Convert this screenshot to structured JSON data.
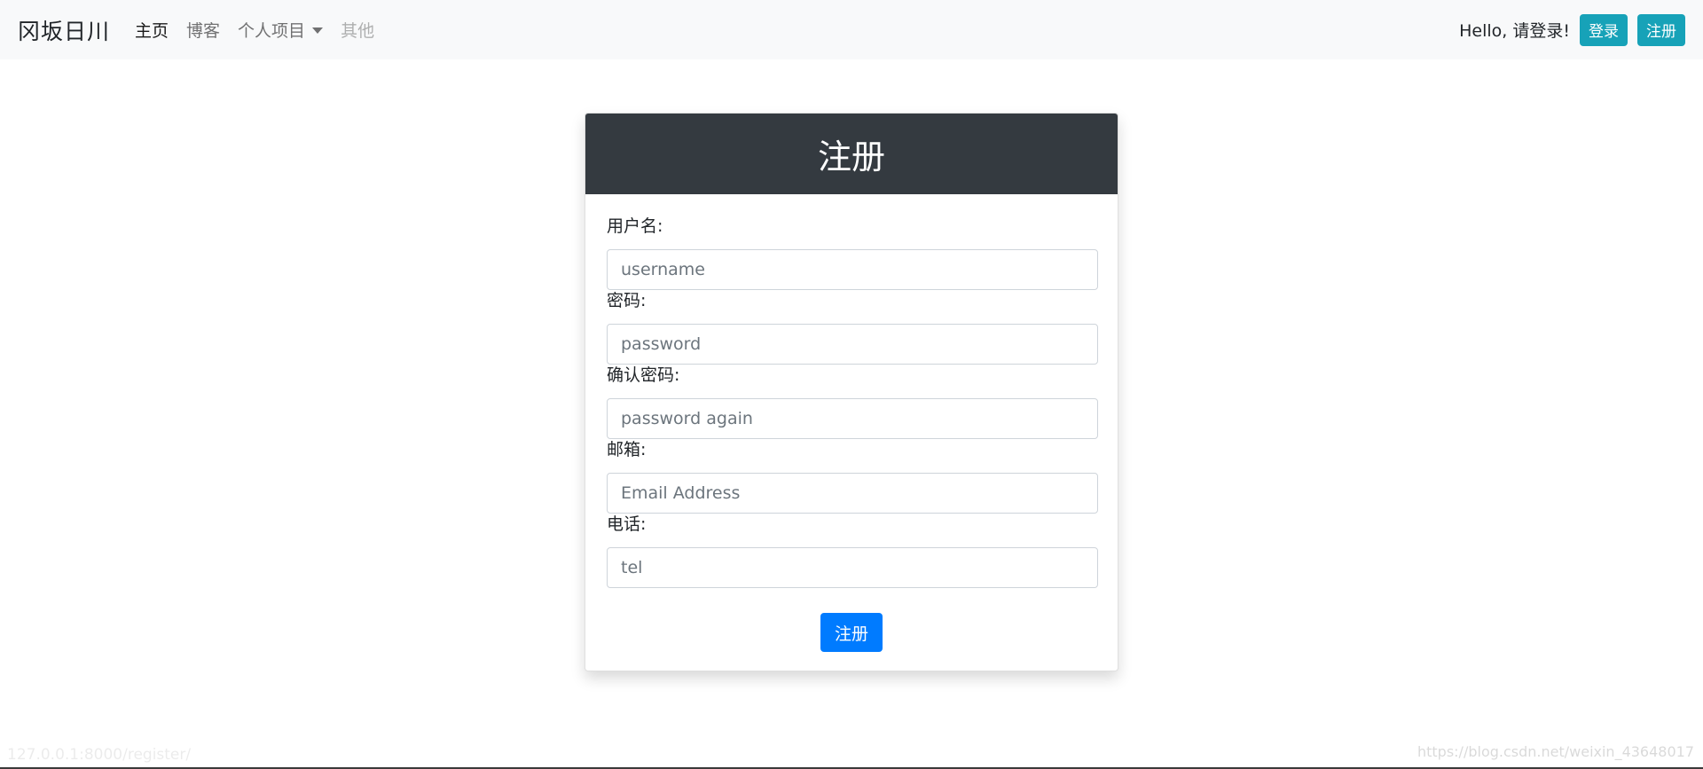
{
  "navbar": {
    "brand": "冈坂日川",
    "links": [
      {
        "label": "主页"
      },
      {
        "label": "博客"
      },
      {
        "label": "个人项目"
      },
      {
        "label": "其他"
      }
    ],
    "greeting": "Hello, 请登录!",
    "login_label": "登录",
    "register_label": "注册"
  },
  "form": {
    "title": "注册",
    "fields": [
      {
        "label": "用户名:",
        "placeholder": "username"
      },
      {
        "label": "密码:",
        "placeholder": "password"
      },
      {
        "label": "确认密码:",
        "placeholder": "password again"
      },
      {
        "label": "邮箱:",
        "placeholder": "Email Address"
      },
      {
        "label": "电话:",
        "placeholder": "tel"
      }
    ],
    "submit_label": "注册"
  },
  "status_url": "127.0.0.1:8000/register/",
  "watermark": "https://blog.csdn.net/weixin_43648017",
  "colors": {
    "navbar_bg": "#f8f9fa",
    "info": "#17a2b8",
    "primary": "#007bff",
    "card_header": "#343a40"
  }
}
